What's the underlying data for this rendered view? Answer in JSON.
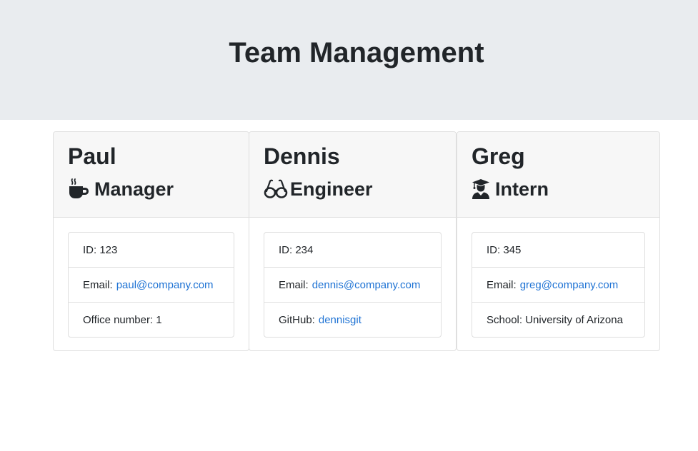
{
  "header": {
    "title": "Team Management"
  },
  "team": [
    {
      "name": "Paul",
      "role": "Manager",
      "icon": "coffee-icon",
      "id_label": "ID: 123",
      "email_label": "Email:",
      "email": "paul@company.com",
      "extra_label": "Office number: 1"
    },
    {
      "name": "Dennis",
      "role": "Engineer",
      "icon": "glasses-icon",
      "id_label": "ID: 234",
      "email_label": "Email:",
      "email": "dennis@company.com",
      "extra_label": "GitHub:",
      "extra_link": "dennisgit"
    },
    {
      "name": "Greg",
      "role": "Intern",
      "icon": "graduate-icon",
      "id_label": "ID: 345",
      "email_label": "Email:",
      "email": "greg@company.com",
      "extra_label": "School: University of Arizona"
    }
  ],
  "colors": {
    "header_bg": "#e9ecef",
    "card_header_bg": "#f7f7f7",
    "link": "#1f73d4",
    "text": "#212529"
  }
}
